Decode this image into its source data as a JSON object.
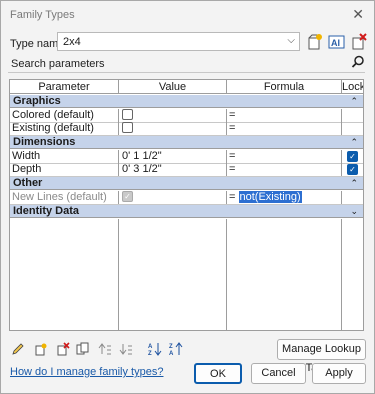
{
  "window": {
    "title": "Family Types"
  },
  "type_name": {
    "label": "Type name:",
    "value": "2x4"
  },
  "search": {
    "placeholder": "Search parameters"
  },
  "table": {
    "headers": {
      "parameter": "Parameter",
      "value": "Value",
      "formula": "Formula",
      "lock": "Lock"
    },
    "groups": [
      {
        "name": "Graphics",
        "rows": [
          {
            "parameter": "Colored (default)",
            "value_checked": false,
            "formula": "=",
            "lock": false
          },
          {
            "parameter": "Existing (default)",
            "value_checked": false,
            "formula": "=",
            "lock": false
          }
        ]
      },
      {
        "name": "Dimensions",
        "rows": [
          {
            "parameter": "Width",
            "value": "0'  1 1/2\"",
            "formula": "=",
            "lock": true
          },
          {
            "parameter": "Depth",
            "value": "0'  3 1/2\"",
            "formula": "=",
            "lock": true
          }
        ]
      },
      {
        "name": "Other",
        "rows": [
          {
            "parameter": "New Lines (default)",
            "value_checked": true,
            "value_disabled": true,
            "formula_prefix": "=",
            "formula": "not(Existing)",
            "lock": false
          }
        ]
      },
      {
        "name": "Identity Data",
        "collapsed": true
      }
    ]
  },
  "buttons": {
    "manage_lookup": "Manage Lookup Tables",
    "ok": "OK",
    "cancel": "Cancel",
    "apply": "Apply"
  },
  "help_link": "How do I manage family types?",
  "icons": [
    "pencil-icon",
    "new-parameter-icon",
    "delete-parameter-icon",
    "duplicate-icon",
    "move-up-icon",
    "move-down-icon",
    "sort-ascending-icon",
    "sort-descending-icon"
  ],
  "colors": {
    "group_header": "#c5d3ea",
    "accent": "#0b5cad",
    "selection": "#2d6fd1"
  }
}
